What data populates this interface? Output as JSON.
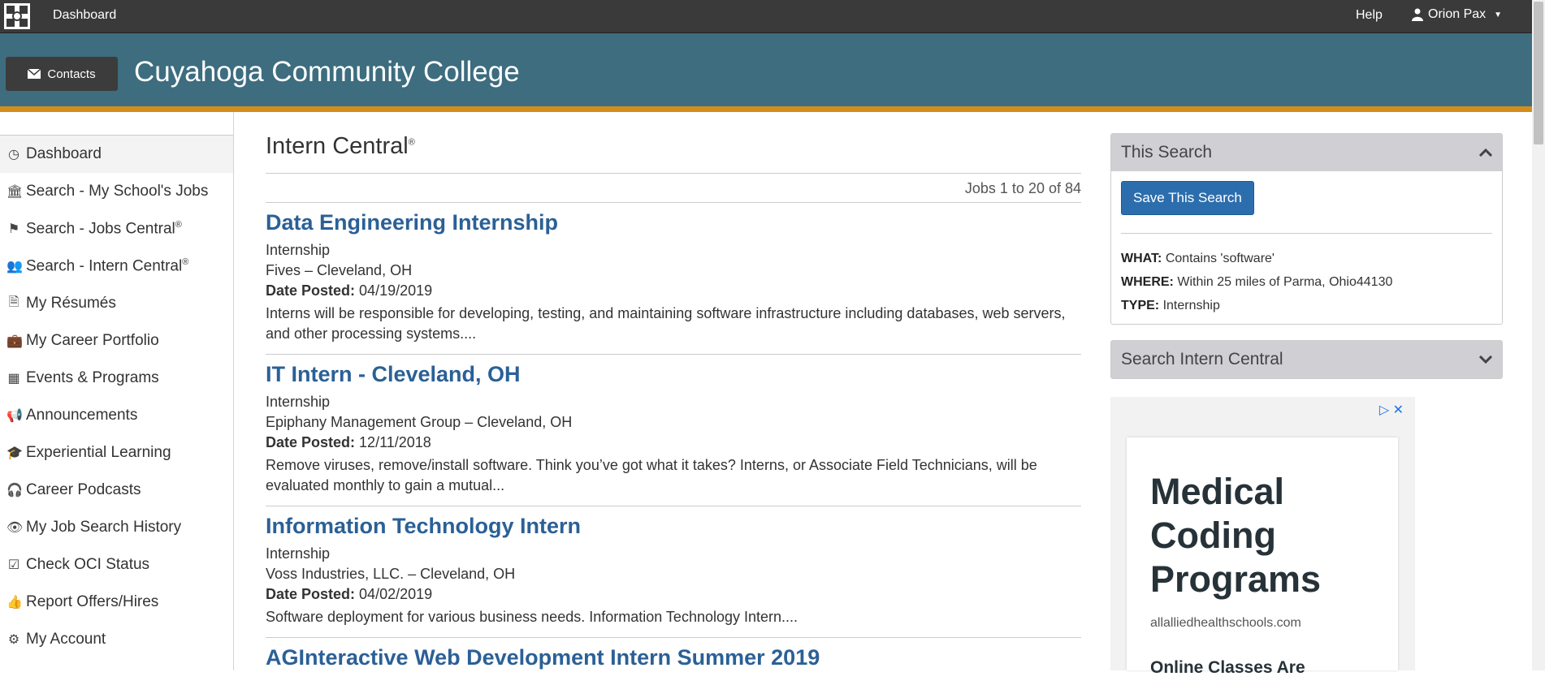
{
  "topbar": {
    "dashboard": "Dashboard",
    "help": "Help",
    "user": "Orion Pax"
  },
  "header": {
    "contacts": "Contacts",
    "title": "Cuyahoga Community College"
  },
  "sidebar": {
    "items": [
      {
        "label": "Dashboard",
        "icon": "clock-icon"
      },
      {
        "label": "Search - My School's Jobs",
        "icon": "institution-icon"
      },
      {
        "label": "Search - Jobs Central",
        "icon": "flag-icon",
        "sup": "®"
      },
      {
        "label": "Search - Intern Central",
        "icon": "users-icon",
        "sup": "®"
      },
      {
        "label": "My Résumés",
        "icon": "file-icon"
      },
      {
        "label": "My Career Portfolio",
        "icon": "briefcase-icon"
      },
      {
        "label": "Events & Programs",
        "icon": "calendar-icon"
      },
      {
        "label": "Announcements",
        "icon": "bullhorn-icon"
      },
      {
        "label": "Experiential Learning",
        "icon": "graduation-cap-icon"
      },
      {
        "label": "Career Podcasts",
        "icon": "headphones-icon"
      },
      {
        "label": "My Job Search History",
        "icon": "eye-icon"
      },
      {
        "label": "Check OCI Status",
        "icon": "check-square-icon"
      },
      {
        "label": "Report Offers/Hires",
        "icon": "thumbs-up-icon"
      },
      {
        "label": "My Account",
        "icon": "cogs-icon"
      }
    ]
  },
  "main": {
    "title": "Intern Central",
    "title_sup": "®",
    "jobs_count": "Jobs 1 to 20 of 84",
    "date_label": "Date Posted:",
    "jobs": [
      {
        "title": "Data Engineering Internship",
        "type": "Internship",
        "company": "Fives – Cleveland, OH",
        "date": "04/19/2019",
        "desc": "Interns will be responsible for developing, testing, and maintaining software infrastructure including databases, web servers, and other processing systems...."
      },
      {
        "title": "IT Intern - Cleveland, OH",
        "type": "Internship",
        "company": "Epiphany Management Group – Cleveland, OH",
        "date": "12/11/2018",
        "desc": "Remove viruses, remove/install software. Think you’ve got what it takes? Interns, or Associate Field Technicians, will be evaluated monthly to gain a mutual..."
      },
      {
        "title": "Information Technology Intern",
        "type": "Internship",
        "company": "Voss Industries, LLC. – Cleveland, OH",
        "date": "04/02/2019",
        "desc": "Software deployment for various business needs. Information Technology Intern...."
      },
      {
        "title": "AGInteractive Web Development Intern Summer 2019",
        "type": "",
        "company": "",
        "date": "",
        "desc": ""
      }
    ]
  },
  "this_search": {
    "heading": "This Search",
    "save_button": "Save This Search",
    "what_label": "WHAT:",
    "what": "Contains 'software'",
    "where_label": "WHERE:",
    "where": "Within 25 miles of Parma, Ohio44130",
    "type_label": "TYPE:",
    "type": "Internship"
  },
  "search_intern": {
    "heading": "Search Intern Central"
  },
  "ad": {
    "headline": "Medical Coding Programs",
    "domain": "allalliedhealthschools.com",
    "sub": "Online Classes Are"
  },
  "colors": {
    "header_bg": "#3d6d7f",
    "accent": "#d28d1d",
    "link": "#2b6096",
    "button": "#2c6ead"
  }
}
